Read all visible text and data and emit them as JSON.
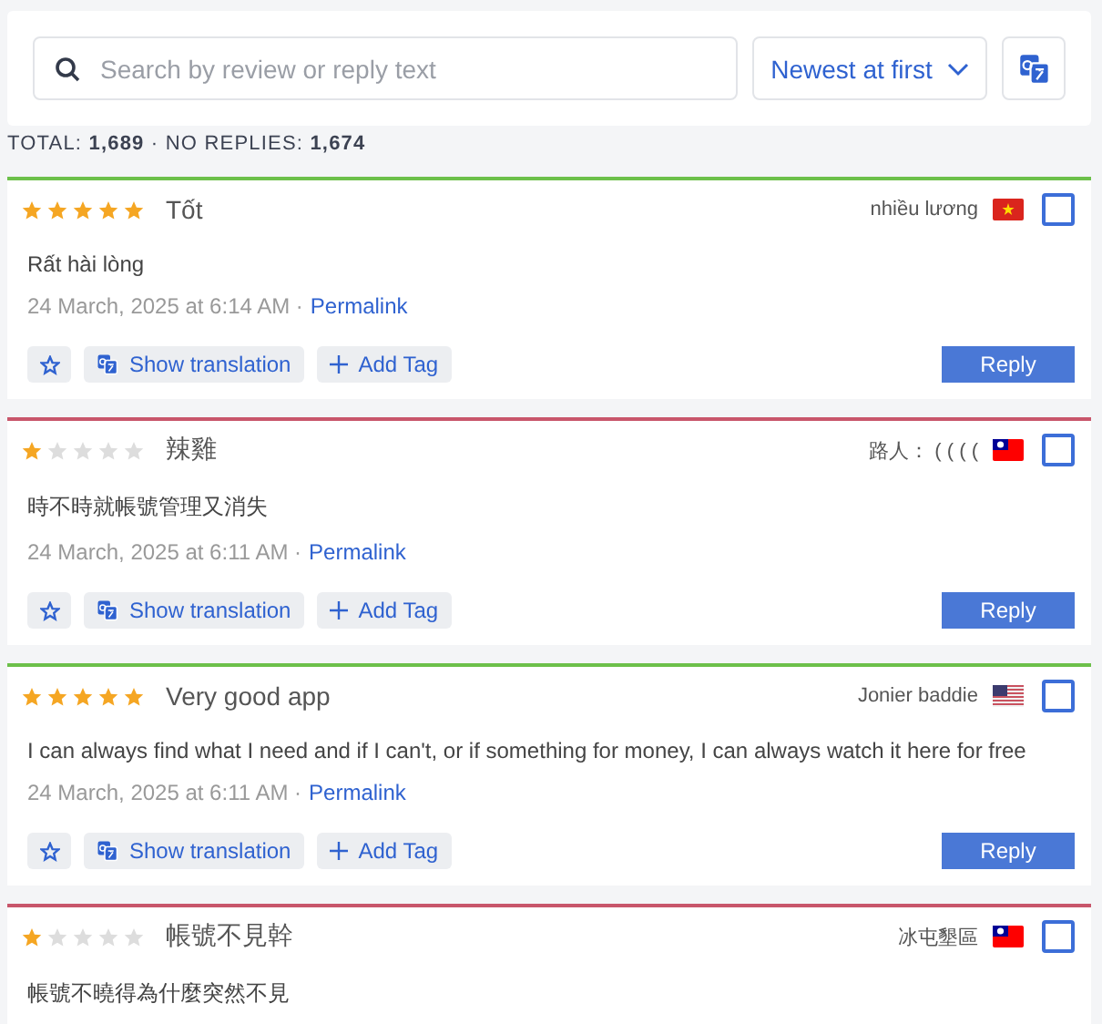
{
  "search": {
    "placeholder": "Search by review or reply text"
  },
  "sort": {
    "label": "Newest at first"
  },
  "stats": "TOTAL: **1,689** · NO REPLIES: **1,674**",
  "reviews": [
    {
      "stars": 5,
      "color": "#6cc04a",
      "title": "Tốt",
      "author": "nhiều lương",
      "kind": "vietnam",
      "checked": false,
      "text": "Rất hài lòng",
      "date": "24 March, 2025 at 6:14 AM ·",
      "permalink": "Permalink",
      "actions": [
        "Show translation",
        "Add Tag"
      ],
      "reply": "Reply"
    },
    {
      "stars": 1,
      "color": "#c8566b",
      "title": "辣雞",
      "author": "路人： ( ( ( (",
      "kind": "taiwan",
      "checked": false,
      "text": "時不時就帳號管理又消失",
      "date": "24 March, 2025 at 6:11 AM ·",
      "permalink": "Permalink",
      "actions": [
        "Show translation",
        "Add Tag"
      ],
      "reply": "Reply"
    },
    {
      "stars": 5,
      "color": "#6cc04a",
      "title": "Very good app",
      "author": "Jonier baddie",
      "kind": "usa",
      "checked": false,
      "text": "I can always find what I need and if I can't, or if something for money, I can always watch it here for free",
      "date": "24 March, 2025 at 6:11 AM ·",
      "permalink": "Permalink",
      "actions": [
        "Show translation",
        "Add Tag"
      ],
      "reply": "Reply"
    },
    {
      "stars": 1,
      "color": "#c8566b",
      "title": "帳號不見幹",
      "author": "冰屯墾區",
      "kind": "taiwan",
      "checked": false,
      "text": "帳號不曉得為什麼突然不見"
    }
  ]
}
